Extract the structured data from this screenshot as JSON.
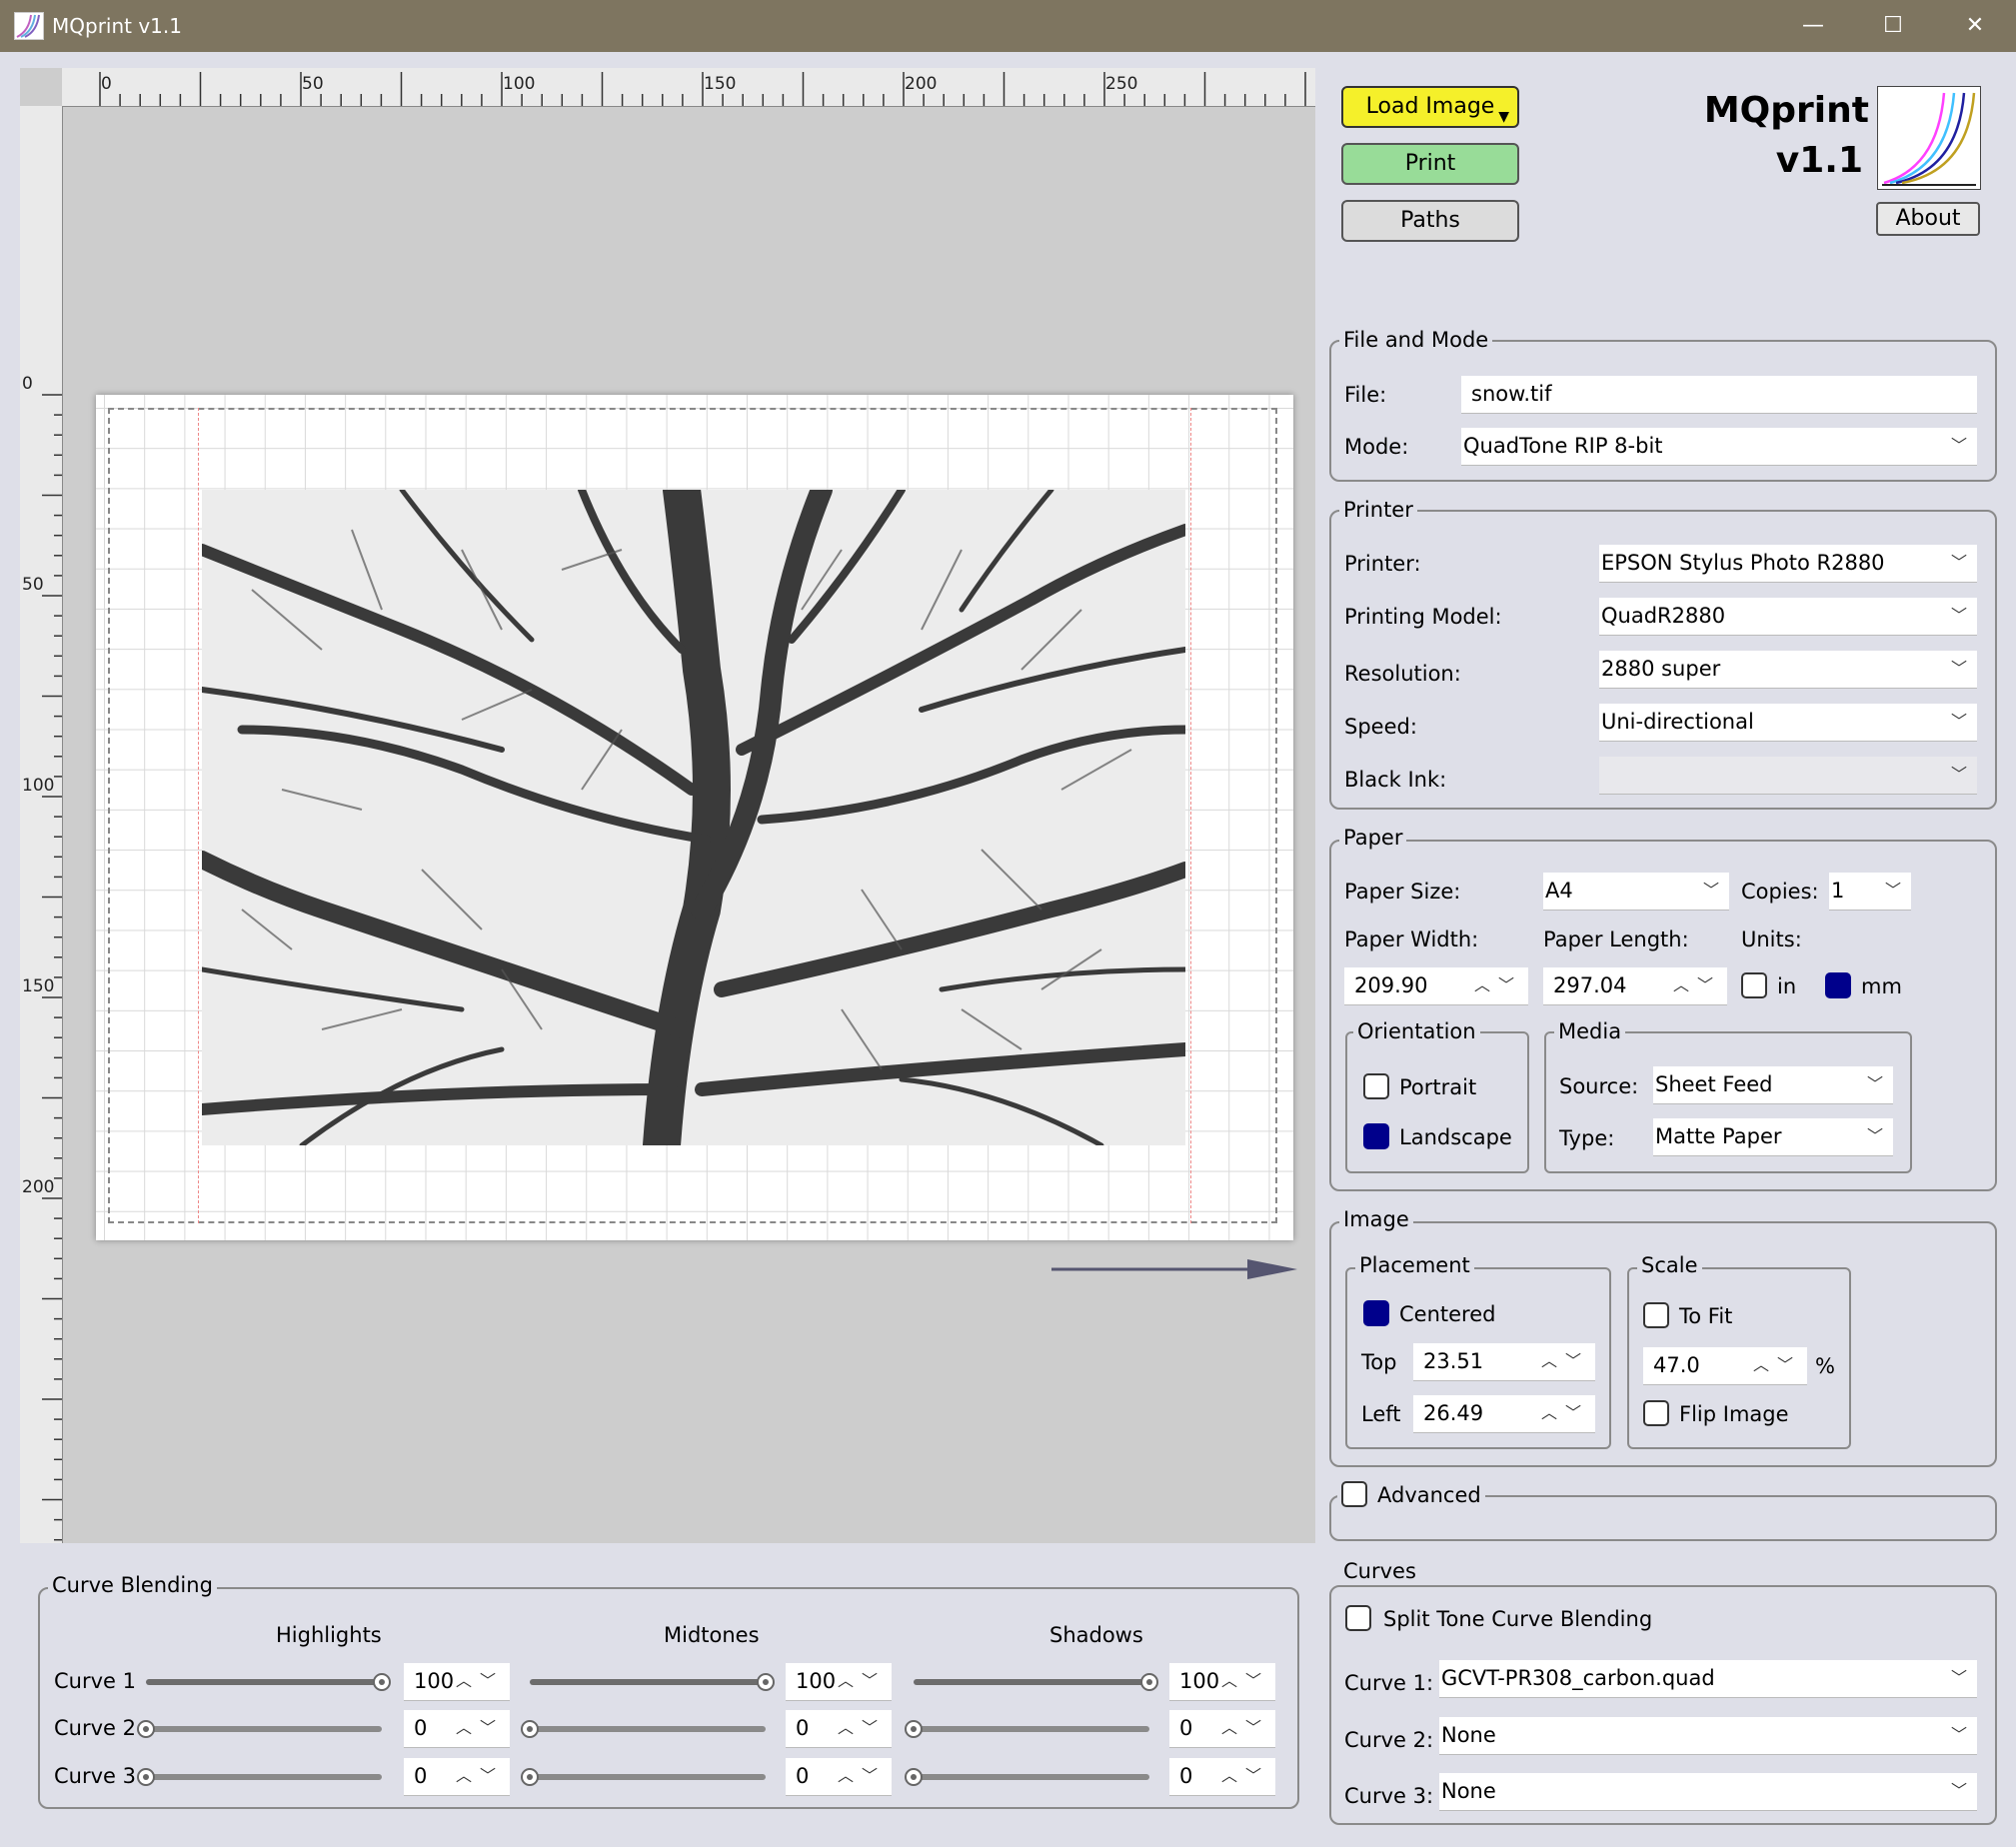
{
  "window": {
    "title": "MQprint v1.1",
    "min_glyph": "—",
    "max_glyph": "☐",
    "close_glyph": "✕"
  },
  "ruler": {
    "top_labels": [
      "0",
      "50",
      "100",
      "150",
      "200",
      "250"
    ],
    "left_labels": [
      "0",
      "50",
      "100",
      "150",
      "200"
    ]
  },
  "buttons": {
    "load_image": "Load Image",
    "print": "Print",
    "paths": "Paths",
    "about": "About"
  },
  "branding": {
    "name": "MQprint",
    "version": "v1.1"
  },
  "colors": {
    "load_image": "#f5f02a",
    "print": "#98dc98",
    "paths": "#dcdcdc",
    "checked": "#00008b",
    "titlebar": "#7e7560"
  },
  "file_mode": {
    "title": "File and Mode",
    "file_label": "File:",
    "file_value": "snow.tif",
    "mode_label": "Mode:",
    "mode_value": "QuadTone RIP 8-bit"
  },
  "printer": {
    "title": "Printer",
    "printer_label": "Printer:",
    "printer_value": "EPSON Stylus Photo R2880",
    "model_label": "Printing Model:",
    "model_value": "QuadR2880",
    "resolution_label": "Resolution:",
    "resolution_value": "2880 super",
    "speed_label": "Speed:",
    "speed_value": "Uni-directional",
    "black_ink_label": "Black Ink:",
    "black_ink_value": ""
  },
  "paper": {
    "title": "Paper",
    "size_label": "Paper Size:",
    "size_value": "A4",
    "copies_label": "Copies:",
    "copies_value": "1",
    "width_label": "Paper Width:",
    "width_value": "209.90",
    "length_label": "Paper Length:",
    "length_value": "297.04",
    "units_label": "Units:",
    "unit_in": "in",
    "unit_mm": "mm",
    "orientation_title": "Orientation",
    "portrait": "Portrait",
    "landscape": "Landscape",
    "media_title": "Media",
    "source_label": "Source:",
    "source_value": "Sheet Feed",
    "type_label": "Type:",
    "type_value": "Matte Paper"
  },
  "image": {
    "title": "Image",
    "placement_title": "Placement",
    "centered": "Centered",
    "top_label": "Top",
    "top_value": "23.51",
    "left_label": "Left",
    "left_value": "26.49",
    "scale_title": "Scale",
    "to_fit": "To Fit",
    "scale_value": "47.0",
    "percent": "%",
    "flip": "Flip Image"
  },
  "advanced": {
    "label": "Advanced"
  },
  "curves": {
    "title": "Curves",
    "split_tone": "Split Tone Curve Blending",
    "curve1_label": "Curve 1:",
    "curve1_value": "GCVT-PR308_carbon.quad",
    "curve2_label": "Curve 2:",
    "curve2_value": "None",
    "curve3_label": "Curve 3:",
    "curve3_value": "None"
  },
  "blending": {
    "title": "Curve Blending",
    "highlights": "Highlights",
    "midtones": "Midtones",
    "shadows": "Shadows",
    "row_labels": [
      "Curve 1",
      "Curve 2",
      "Curve 3"
    ],
    "values": [
      [
        "100",
        "100",
        "100"
      ],
      [
        "0",
        "0",
        "0"
      ],
      [
        "0",
        "0",
        "0"
      ]
    ],
    "levels": [
      [
        1,
        1,
        1
      ],
      [
        0,
        0,
        0
      ],
      [
        0,
        0,
        0
      ]
    ]
  },
  "icons": {
    "dropdown": "chevron-down-icon",
    "spin_up": "chevron-up-icon",
    "spin_down": "chevron-down-icon"
  }
}
